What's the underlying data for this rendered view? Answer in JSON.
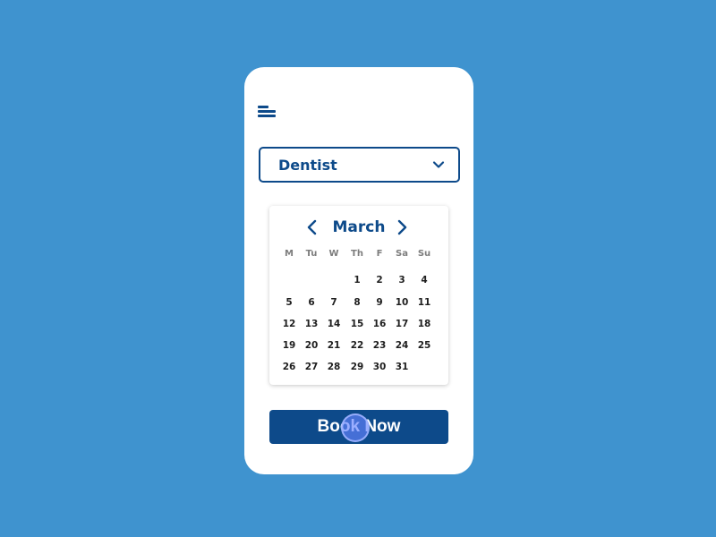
{
  "header": {
    "menu_icon": "hamburger-menu-icon"
  },
  "service_select": {
    "value": "Dentist",
    "icon": "chevron-down-icon"
  },
  "calendar": {
    "month": "March",
    "prev_icon": "chevron-left-icon",
    "next_icon": "chevron-right-icon",
    "weekdays": [
      "M",
      "Tu",
      "W",
      "Th",
      "F",
      "Sa",
      "Su"
    ],
    "weeks": [
      [
        "",
        "",
        "",
        "1",
        "2",
        "3",
        "4"
      ],
      [
        "5",
        "6",
        "7",
        "8",
        "9",
        "10",
        "11"
      ],
      [
        "12",
        "13",
        "14",
        "15",
        "16",
        "17",
        "18"
      ],
      [
        "19",
        "20",
        "21",
        "22",
        "23",
        "24",
        "25"
      ],
      [
        "26",
        "27",
        "28",
        "29",
        "30",
        "31",
        ""
      ]
    ]
  },
  "actions": {
    "book_label": "Book Now"
  },
  "colors": {
    "background": "#3f93cf",
    "primary": "#0d4a8a",
    "card": "#ffffff",
    "touch_indicator": "#6482ff"
  }
}
